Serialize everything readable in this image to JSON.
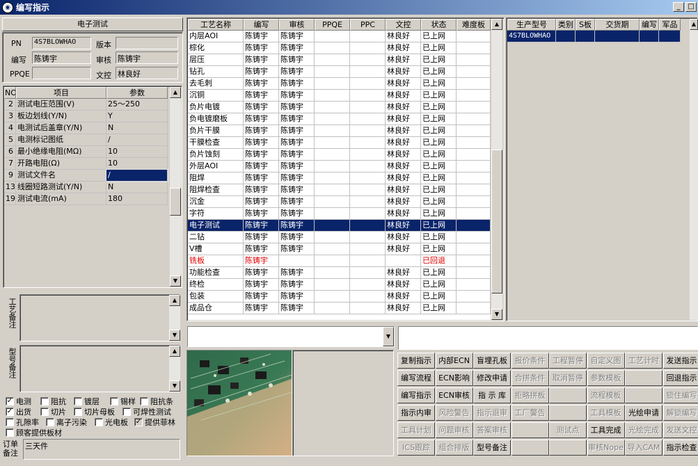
{
  "window": {
    "title": "编写指示"
  },
  "left": {
    "section_title": "电子测试",
    "pn_label": "PN",
    "pn_value": "4S7BLOWHAO",
    "version_label": "版本",
    "version_value": "",
    "writer_label": "编写",
    "writer_value": "陈铸宇",
    "reviewer_label": "审核",
    "reviewer_value": "陈铸宇",
    "ppqe_label": "PPQE",
    "ppqe_value": "",
    "doc_label": "文控",
    "doc_value": "林良好",
    "param_headers": [
      "NO",
      "项目",
      "参数"
    ],
    "params": [
      {
        "no": "2",
        "item": "测试电压范围(V)",
        "value": "25～250"
      },
      {
        "no": "3",
        "item": "板边划线(Y/N)",
        "value": "Y"
      },
      {
        "no": "4",
        "item": "电测试后盖章(Y/N)",
        "value": "N"
      },
      {
        "no": "5",
        "item": "电测标记图纸",
        "value": "/"
      },
      {
        "no": "6",
        "item": "最小绝缘电阻(MΩ)",
        "value": "10"
      },
      {
        "no": "7",
        "item": "开路电阻(Ω)",
        "value": "10"
      },
      {
        "no": "9",
        "item": "测试文件名",
        "value": "/"
      },
      {
        "no": "13",
        "item": "线圈短路测试(Y/N)",
        "value": "N"
      },
      {
        "no": "19",
        "item": "测试电流(mA)",
        "value": "180"
      }
    ],
    "process_note_label": "工艺备注",
    "model_note_label": "型号备注",
    "checkboxes": [
      {
        "label": "电测",
        "checked": true
      },
      {
        "label": "阻抗",
        "checked": false
      },
      {
        "label": "镀层",
        "checked": false
      },
      {
        "label": "锡样",
        "checked": false
      },
      {
        "label": "阻抗条",
        "checked": false
      },
      {
        "label": "出货",
        "checked": true
      },
      {
        "label": "切片",
        "checked": false
      },
      {
        "label": "切片母板",
        "checked": false
      },
      {
        "label": "可焊性测试",
        "checked": false
      },
      {
        "label": "孔隙率",
        "checked": false
      },
      {
        "label": "离子污染",
        "checked": false
      },
      {
        "label": "光电板",
        "checked": false
      },
      {
        "label": "提供菲林",
        "checked": true
      },
      {
        "label": "顾客提供板材",
        "checked": false
      }
    ],
    "order_note_label": "订单备注",
    "order_note_value": "三天件"
  },
  "process_grid": {
    "headers": [
      "工艺名称",
      "编写",
      "审核",
      "PPQE",
      "PPC",
      "文控",
      "状态",
      "难度板"
    ],
    "rows": [
      [
        "内层AOI",
        "陈铸宇",
        "陈铸宇",
        "",
        "",
        "林良好",
        "已上网",
        ""
      ],
      [
        "棕化",
        "陈铸宇",
        "陈铸宇",
        "",
        "",
        "林良好",
        "已上网",
        ""
      ],
      [
        "层压",
        "陈铸宇",
        "陈铸宇",
        "",
        "",
        "林良好",
        "已上网",
        ""
      ],
      [
        "钻孔",
        "陈铸宇",
        "陈铸宇",
        "",
        "",
        "林良好",
        "已上网",
        ""
      ],
      [
        "去毛刺",
        "陈铸宇",
        "陈铸宇",
        "",
        "",
        "林良好",
        "已上网",
        ""
      ],
      [
        "沉铜",
        "陈铸宇",
        "陈铸宇",
        "",
        "",
        "林良好",
        "已上网",
        ""
      ],
      [
        "负片电镀",
        "陈铸宇",
        "陈铸宇",
        "",
        "",
        "林良好",
        "已上网",
        ""
      ],
      [
        "负电镀磨板",
        "陈铸宇",
        "陈铸宇",
        "",
        "",
        "林良好",
        "已上网",
        ""
      ],
      [
        "负片干膜",
        "陈铸宇",
        "陈铸宇",
        "",
        "",
        "林良好",
        "已上网",
        ""
      ],
      [
        "干膜检查",
        "陈铸宇",
        "陈铸宇",
        "",
        "",
        "林良好",
        "已上网",
        ""
      ],
      [
        "负片蚀刻",
        "陈铸宇",
        "陈铸宇",
        "",
        "",
        "林良好",
        "已上网",
        ""
      ],
      [
        "外层AOI",
        "陈铸宇",
        "陈铸宇",
        "",
        "",
        "林良好",
        "已上网",
        ""
      ],
      [
        "阻焊",
        "陈铸宇",
        "陈铸宇",
        "",
        "",
        "林良好",
        "已上网",
        ""
      ],
      [
        "阻焊检查",
        "陈铸宇",
        "陈铸宇",
        "",
        "",
        "林良好",
        "已上网",
        ""
      ],
      [
        "沉金",
        "陈铸宇",
        "陈铸宇",
        "",
        "",
        "林良好",
        "已上网",
        ""
      ],
      [
        "字符",
        "陈铸宇",
        "陈铸宇",
        "",
        "",
        "林良好",
        "已上网",
        ""
      ],
      [
        "电子测试",
        "陈铸宇",
        "陈铸宇",
        "",
        "",
        "林良好",
        "已上网",
        ""
      ],
      [
        "二钻",
        "陈铸宇",
        "陈铸宇",
        "",
        "",
        "林良好",
        "已上网",
        ""
      ],
      [
        "V槽",
        "陈铸宇",
        "陈铸宇",
        "",
        "",
        "林良好",
        "已上网",
        ""
      ],
      [
        "铣板",
        "陈铸宇",
        "",
        "",
        "",
        "",
        "已回退",
        ""
      ],
      [
        "功能检查",
        "陈铸宇",
        "陈铸宇",
        "",
        "",
        "林良好",
        "已上网",
        ""
      ],
      [
        "终检",
        "陈铸宇",
        "陈铸宇",
        "",
        "",
        "林良好",
        "已上网",
        ""
      ],
      [
        "包装",
        "陈铸宇",
        "陈铸宇",
        "",
        "",
        "林良好",
        "已上网",
        ""
      ],
      [
        "成品仓",
        "陈铸宇",
        "陈铸宇",
        "",
        "",
        "林良好",
        "已上网",
        ""
      ]
    ],
    "selected_row": 16,
    "red_row": 19
  },
  "production_grid": {
    "headers": [
      "生产型号",
      "类别",
      "S板",
      "交货期",
      "编写",
      "军品"
    ],
    "rows": [
      [
        "4S7BLOWHAO",
        "",
        "",
        "",
        "",
        ""
      ]
    ]
  },
  "buttons": [
    {
      "label": "复制指示",
      "enabled": true
    },
    {
      "label": "内部ECN",
      "enabled": true
    },
    {
      "label": "盲埋孔板",
      "enabled": true
    },
    {
      "label": "报价条件",
      "enabled": false
    },
    {
      "label": "工程暂停",
      "enabled": false
    },
    {
      "label": "自定义图",
      "enabled": false
    },
    {
      "label": "工艺计时",
      "enabled": false
    },
    {
      "label": "发送指示",
      "enabled": true
    },
    {
      "label": "编写流程",
      "enabled": true
    },
    {
      "label": "ECN影响",
      "enabled": true
    },
    {
      "label": "修改申请",
      "enabled": true
    },
    {
      "label": "合拼条件",
      "enabled": false
    },
    {
      "label": "取消暂停",
      "enabled": false
    },
    {
      "label": "参数模板",
      "enabled": false
    },
    {
      "label": "",
      "enabled": false
    },
    {
      "label": "回退指示",
      "enabled": true
    },
    {
      "label": "编写指示",
      "enabled": true
    },
    {
      "label": "ECN审核",
      "enabled": true
    },
    {
      "label": "指 示 库",
      "enabled": true
    },
    {
      "label": "拒略拼板",
      "enabled": false
    },
    {
      "label": "",
      "enabled": false
    },
    {
      "label": "流程模板",
      "enabled": false
    },
    {
      "label": "",
      "enabled": false
    },
    {
      "label": "锁住编写",
      "enabled": false
    },
    {
      "label": "指示内审",
      "enabled": true
    },
    {
      "label": "风险警告",
      "enabled": false
    },
    {
      "label": "指示退审",
      "enabled": false
    },
    {
      "label": "工厂警告",
      "enabled": false
    },
    {
      "label": "",
      "enabled": false
    },
    {
      "label": "工具模板",
      "enabled": false
    },
    {
      "label": "光绘申请",
      "enabled": true
    },
    {
      "label": "解锁编写",
      "enabled": false
    },
    {
      "label": "工具计划",
      "enabled": false
    },
    {
      "label": "问题审核",
      "enabled": false
    },
    {
      "label": "答案审核",
      "enabled": false
    },
    {
      "label": "",
      "enabled": false
    },
    {
      "label": "测试点",
      "enabled": false
    },
    {
      "label": "工具完成",
      "enabled": true
    },
    {
      "label": "光绘完成",
      "enabled": false
    },
    {
      "label": "发送文控",
      "enabled": false
    },
    {
      "label": "ICS跟踪",
      "enabled": false
    },
    {
      "label": "组合排版",
      "enabled": false
    },
    {
      "label": "型号备注",
      "enabled": true
    },
    {
      "label": "",
      "enabled": false
    },
    {
      "label": "",
      "enabled": false
    },
    {
      "label": "审核Nope",
      "enabled": false
    },
    {
      "label": "导入CAM",
      "enabled": false
    },
    {
      "label": "指示检查",
      "enabled": true
    }
  ]
}
